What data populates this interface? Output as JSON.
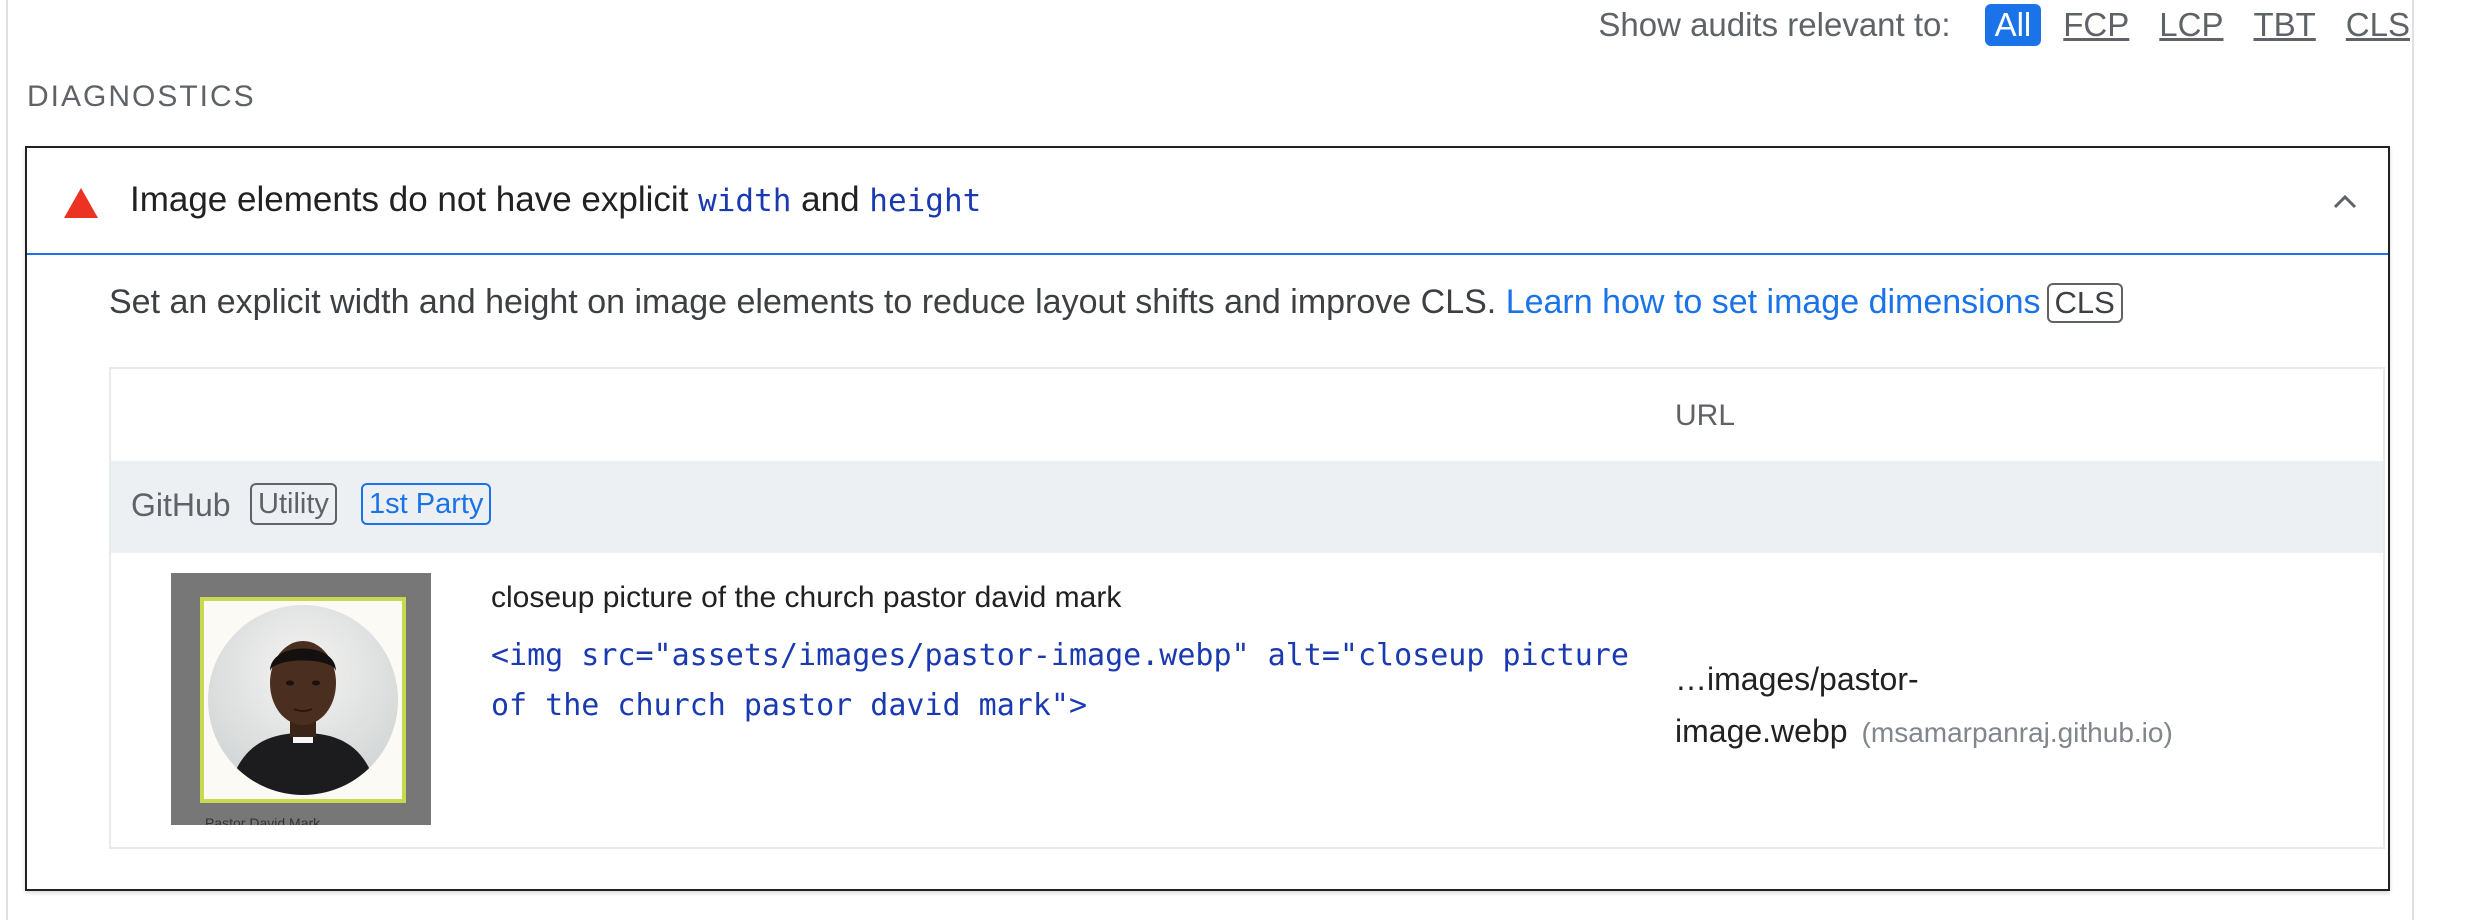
{
  "filter": {
    "label": "Show audits relevant to:",
    "chips": [
      "All",
      "FCP",
      "LCP",
      "TBT",
      "CLS"
    ],
    "active": "All",
    "accent": "#1a73e8"
  },
  "section": {
    "title": "DIAGNOSTICS"
  },
  "audit": {
    "icon": "warning-triangle-icon",
    "icon_color": "#eb3223",
    "title_prefix": "Image elements do not have explicit ",
    "title_code1": "width",
    "title_mid": " and ",
    "title_code2": "height",
    "description": "Set an explicit width and height on image elements to reduce layout shifts and improve CLS. ",
    "learn_link": "Learn how to set image dimensions",
    "metric_badge": "CLS",
    "table": {
      "url_header": "URL",
      "entity": {
        "name": "GitHub",
        "tags": [
          "Utility",
          "1st Party"
        ]
      },
      "rows": [
        {
          "thumb_caption": "Pastor David Mark",
          "node_label": "closeup picture of the church pastor david mark",
          "node_snippet": "<img src=\"assets/images/pastor-image.webp\" alt=\"closeup picture of the church pastor david mark\">",
          "url_line1": "…images/pastor-",
          "url_line2": "image.webp",
          "url_host": "(msamarpanraj.github.io)"
        }
      ]
    }
  }
}
